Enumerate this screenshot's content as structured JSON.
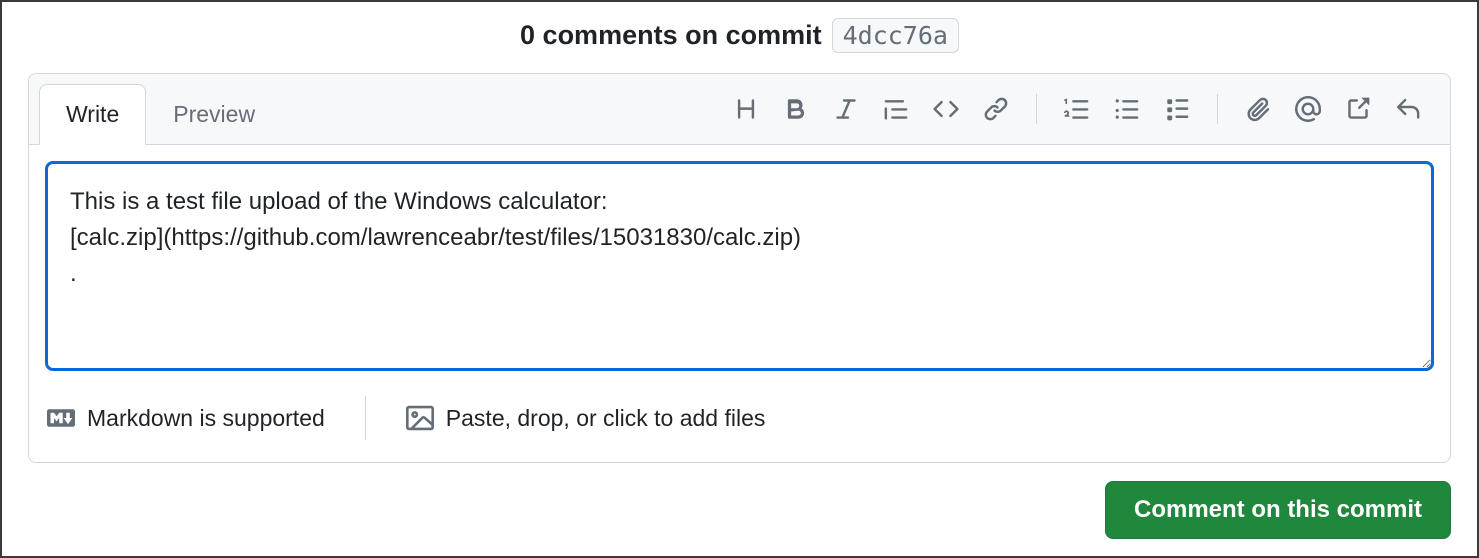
{
  "header": {
    "title": "0 comments on commit",
    "commit_hash": "4dcc76a"
  },
  "tabs": {
    "write": "Write",
    "preview": "Preview"
  },
  "editor": {
    "value": "This is a test file upload of the Windows calculator:\n[calc.zip](https://github.com/lawrenceabr/test/files/15031830/calc.zip)\n."
  },
  "footer": {
    "markdown": "Markdown is supported",
    "attach": "Paste, drop, or click to add files"
  },
  "actions": {
    "submit": "Comment on this commit"
  },
  "icons": {
    "heading": "heading-icon",
    "bold": "bold-icon",
    "italic": "italic-icon",
    "quote": "quote-icon",
    "code": "code-icon",
    "link": "link-icon",
    "ordered_list": "ordered-list-icon",
    "unordered_list": "unordered-list-icon",
    "task_list": "task-list-icon",
    "attach": "attach-icon",
    "mention": "mention-icon",
    "reference": "reference-icon",
    "reply": "reply-icon"
  }
}
